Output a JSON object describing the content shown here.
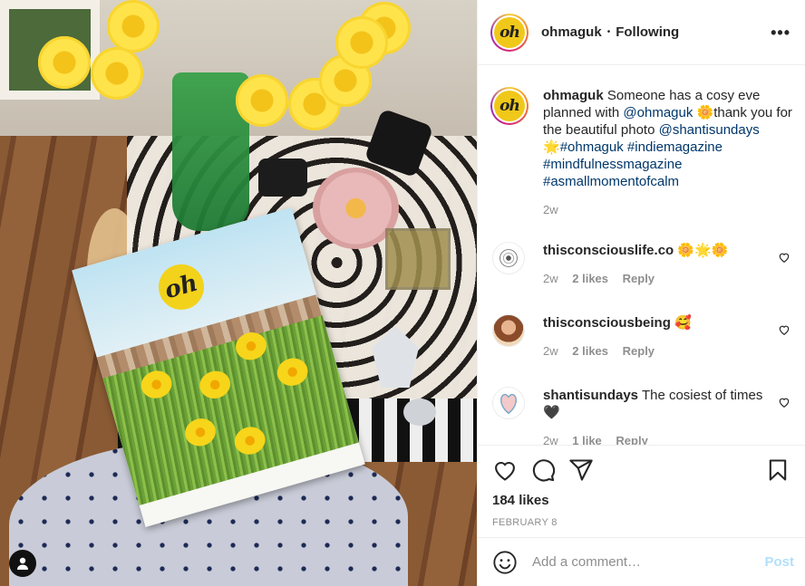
{
  "post": {
    "username": "ohmaguk",
    "separator": "•",
    "follow_status": "Following",
    "more_icon": "more-horizontal-icon",
    "avatar_text": "oh",
    "brand_color": "#f0c81a"
  },
  "caption": {
    "username": "ohmaguk",
    "text_1": "Someone has a cosy eve planned with ",
    "mention_1": "@ohmaguk",
    "emoji_1": "🌼",
    "text_2": "thank you for the beautiful photo ",
    "mention_2": "@shantisundays",
    "emoji_2": "🌟",
    "tags": [
      "#ohmaguk",
      "#indiemagazine",
      "#mindfulnessmagazine",
      "#asmallmomentofcalm"
    ],
    "time": "2w"
  },
  "comments": [
    {
      "username": "thisconsciouslife.co",
      "text": "🌼🌟🌼",
      "time": "2w",
      "likes": "2 likes",
      "reply": "Reply"
    },
    {
      "username": "thisconsciousbeing",
      "text": "🥰",
      "time": "2w",
      "likes": "2 likes",
      "reply": "Reply"
    },
    {
      "username": "shantisundays",
      "text": "The cosiest of times 🖤",
      "time": "2w",
      "likes": "1 like",
      "reply": "Reply"
    }
  ],
  "actions": {
    "like_icon": "heart-icon",
    "comment_icon": "comment-icon",
    "share_icon": "share-icon",
    "save_icon": "bookmark-icon",
    "likes": "184 likes",
    "date": "FEBRUARY 8"
  },
  "add_comment": {
    "placeholder": "Add a comment…",
    "post_label": "Post",
    "emoji_icon": "smiley-icon"
  },
  "photo": {
    "magazine_logo": "oh",
    "tag_icon": "user-tag-icon"
  },
  "colors": {
    "link": "#00376b",
    "muted": "#8e8e8e",
    "post_disabled": "#b2dffc"
  }
}
